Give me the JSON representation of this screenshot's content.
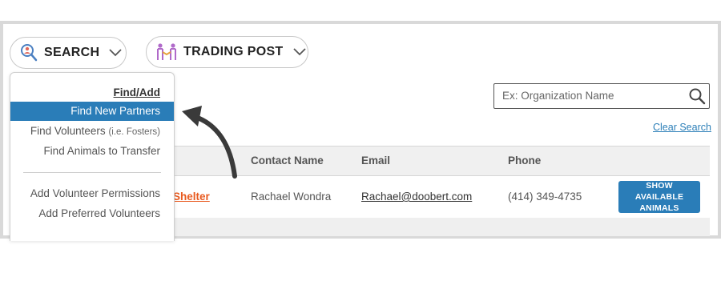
{
  "nav": {
    "search": {
      "label": "SEARCH",
      "icon": "magnifier-person-icon"
    },
    "trading_post": {
      "label": "TRADING POST",
      "icon": "handshake-people-icon"
    }
  },
  "dropdown": {
    "header": "Find/Add",
    "items": [
      {
        "label": "Find New Partners",
        "active": true
      },
      {
        "label": "Find Volunteers",
        "note": "(i.e. Fosters)"
      },
      {
        "label": "Find Animals to Transfer"
      },
      {
        "label": "Add Volunteer Permissions"
      },
      {
        "label": "Add Preferred Volunteers"
      }
    ]
  },
  "search": {
    "placeholder": "Ex: Organization Name",
    "value": "",
    "clear_label": "Clear Search"
  },
  "table": {
    "columns": [
      "Contact Name",
      "Email",
      "Phone"
    ],
    "rows": [
      {
        "organization": "Shelter",
        "contact": "Rachael Wondra",
        "email": "Rachael@doobert.com",
        "phone": "(414) 349-4735",
        "action": "SHOW AVAILABLE ANIMALS"
      }
    ]
  },
  "colors": {
    "accent": "#2a7db8",
    "link_orange": "#e85a1f",
    "frame_border": "#d9d9d9"
  }
}
